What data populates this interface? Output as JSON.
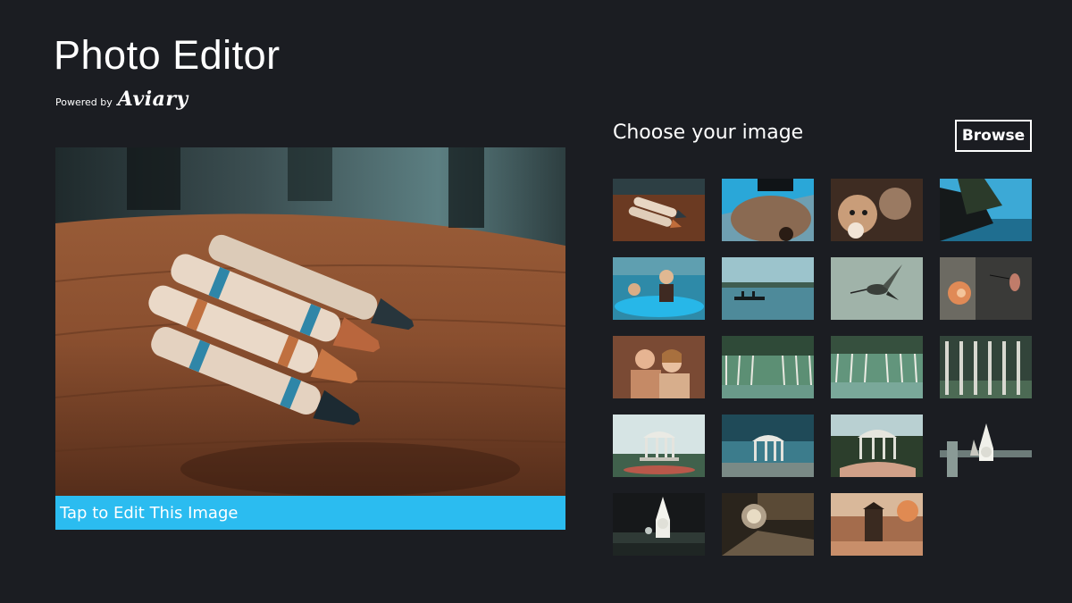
{
  "app": {
    "title": "Photo Editor",
    "powered_by": "Powered by",
    "brand": "Aviary"
  },
  "preview": {
    "edit_label": "Tap to Edit This Image",
    "accent": "#2bbcf0"
  },
  "gallery": {
    "title": "Choose your image",
    "browse_label": "Browse",
    "thumbnails": [
      "crayons",
      "dog-closeup",
      "dog-puppies",
      "tree-lake",
      "girls-in-pool",
      "lake-boat",
      "hummingbird",
      "hummingbird-flower",
      "couple-portrait",
      "deck-fisheye",
      "deck-fisheye-2",
      "fence-trees",
      "gazebo",
      "gazebo-2",
      "gazebo-3",
      "garden-gnome",
      "garden-gnome-2",
      "street-lamp",
      "outhouse-autumn"
    ]
  }
}
